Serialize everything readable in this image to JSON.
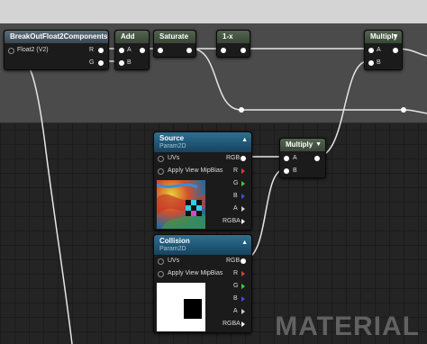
{
  "nodes": {
    "breakout": {
      "title": "BreakOutFloat2Components",
      "input": "Float2 (V2)",
      "out_r": "R",
      "out_g": "G"
    },
    "add": {
      "title": "Add",
      "in_a": "A",
      "in_b": "B"
    },
    "saturate": {
      "title": "Saturate"
    },
    "one_minus": {
      "title": "1-x"
    },
    "multiply_top": {
      "title": "Multiply",
      "in_a": "A",
      "in_b": "B"
    },
    "multiply_mid": {
      "title": "Multiply",
      "in_a": "A",
      "in_b": "B"
    },
    "source": {
      "title": "Source",
      "subtitle": "Param2D",
      "uvs": "UVs",
      "mip": "Apply View MipBias",
      "rgb": "RGB",
      "r": "R",
      "g": "G",
      "b": "B",
      "a": "A",
      "rgba": "RGBA"
    },
    "collision": {
      "title": "Collision",
      "subtitle": "Param2D",
      "uvs": "UVs",
      "mip": "Apply View MipBias",
      "rgb": "RGB",
      "r": "R",
      "g": "G",
      "b": "B",
      "a": "A",
      "rgba": "RGBA"
    }
  },
  "watermark": "MATERIAL",
  "colors": {
    "comment_bg": "#4b4b4b",
    "param_header": "#1f5a7c",
    "pin_r": "#e03a3a",
    "pin_g": "#3ad13a",
    "pin_b": "#3a4de0"
  }
}
